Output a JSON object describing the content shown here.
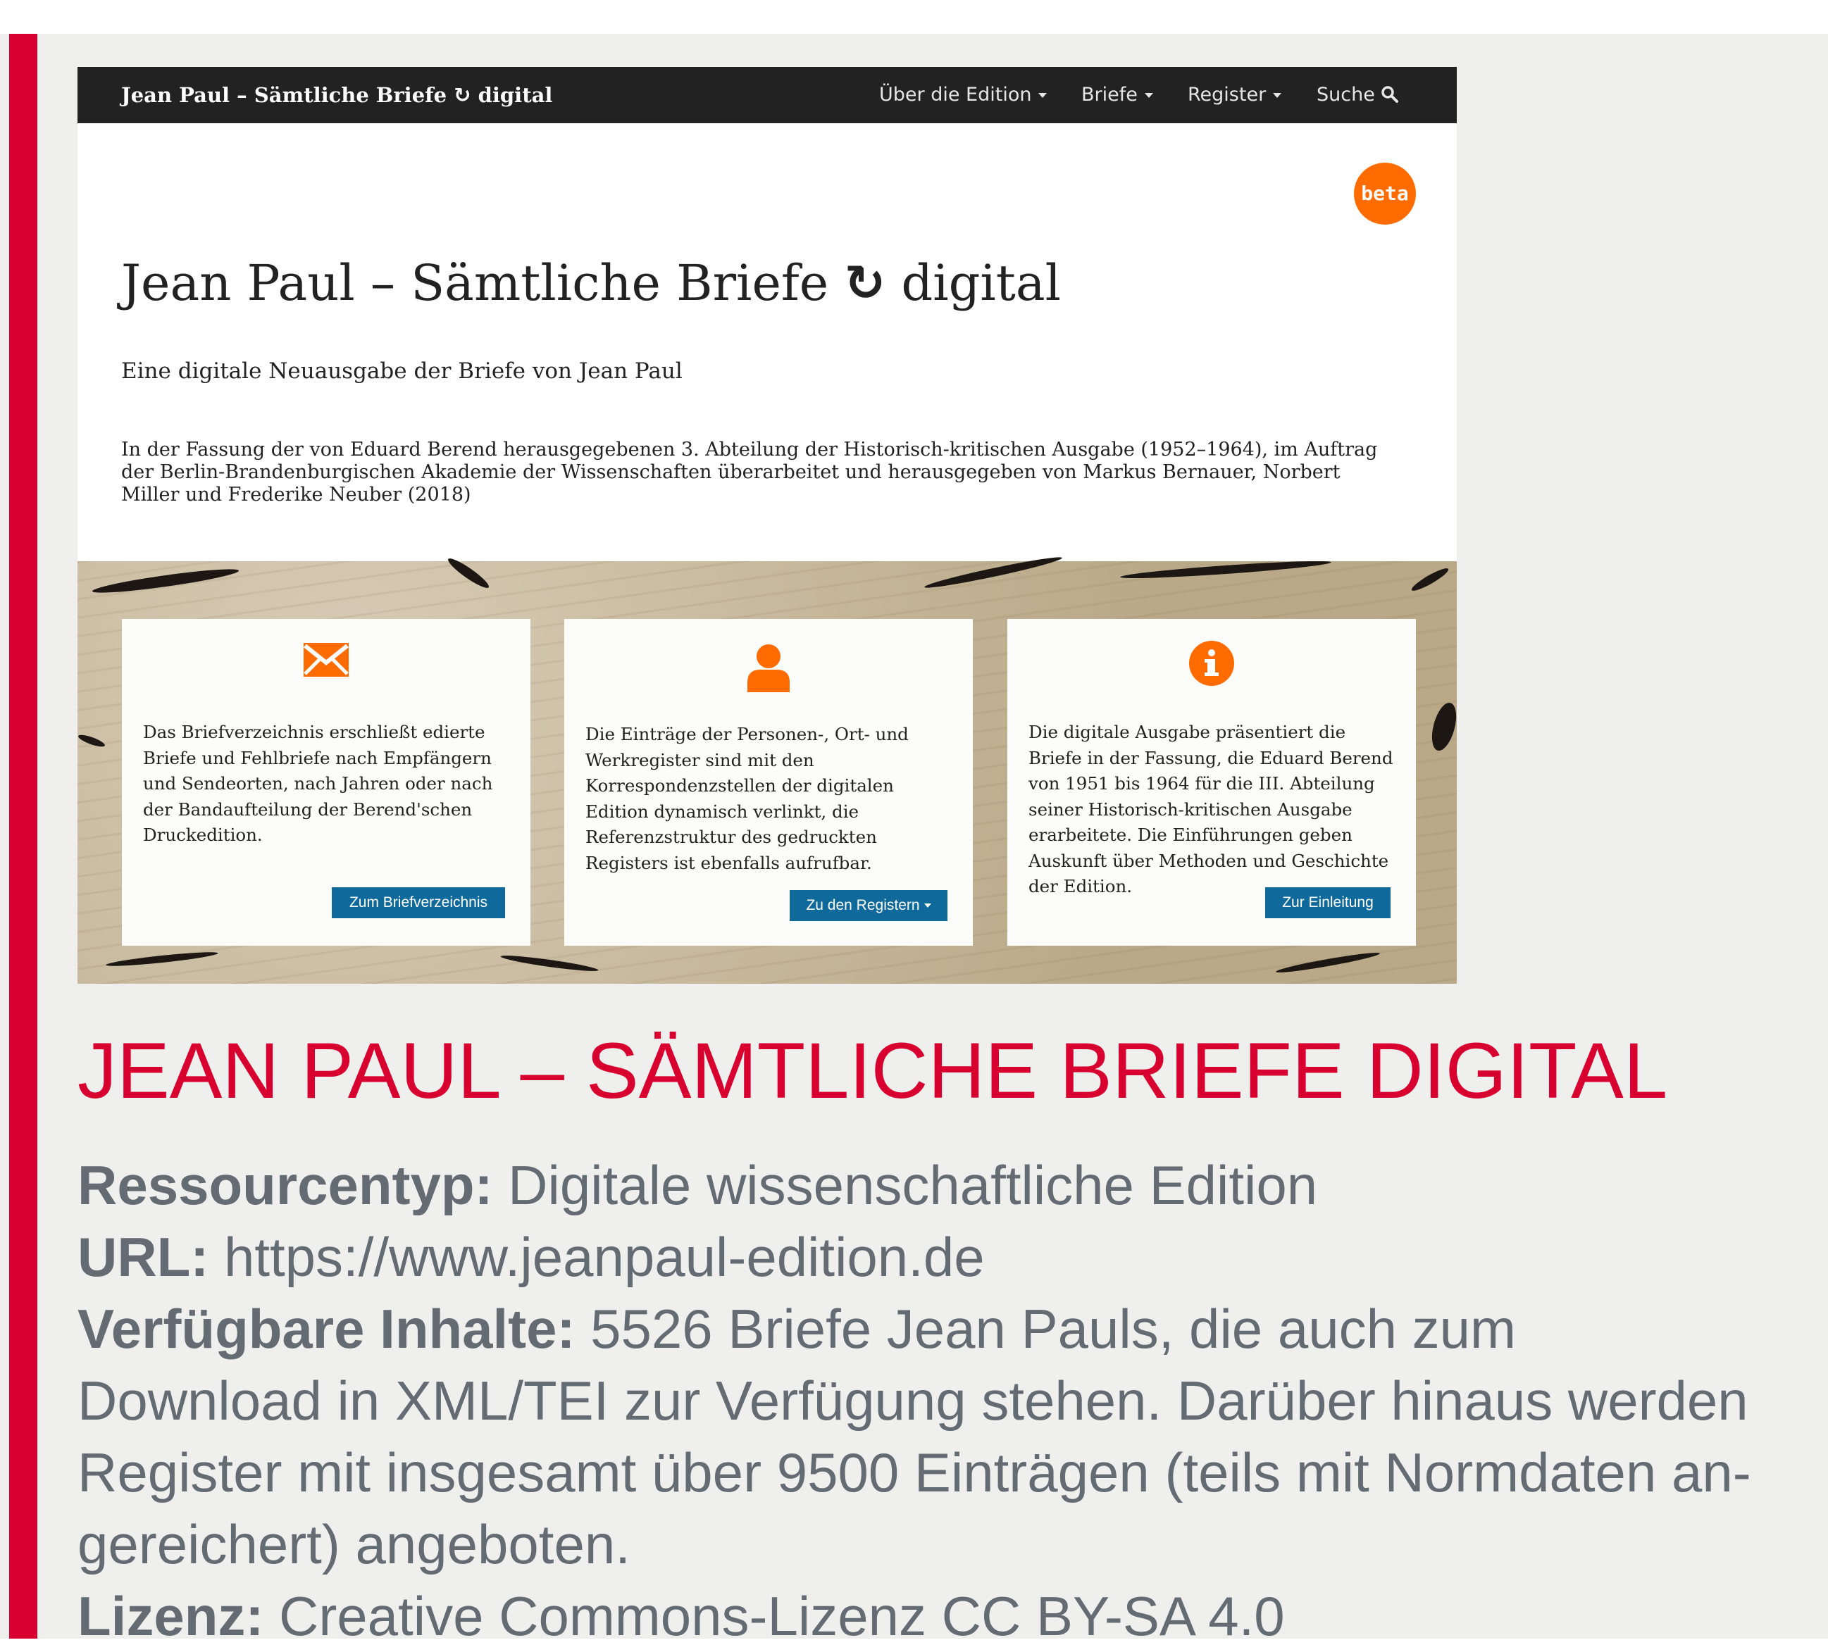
{
  "site": {
    "nav": {
      "brand_pre": "Jean Paul – Sämtliche Briefe",
      "brand_post": "digital",
      "items": [
        {
          "label": "Über die Edition"
        },
        {
          "label": "Briefe"
        },
        {
          "label": "Register"
        }
      ],
      "search_label": "Suche"
    },
    "beta_badge": "beta",
    "title_pre": "Jean Paul – Sämtliche Briefe",
    "title_post": "digital",
    "subtitle": "Eine digitale Neuausgabe der Briefe von Jean Paul",
    "intro": "In der Fassung der von Eduard Berend herausgegebenen 3. Abteilung der Historisch-kritischen Ausgabe (1952–1964), im Auftrag der Berlin-Brandenburgischen Akademie der Wissenschaften überarbeitet und herausgegeben von Markus Bernauer, Norbert Miller und Frederike Neuber (2018)",
    "cards": [
      {
        "icon": "envelope-icon",
        "text": "Das Briefverzeichnis erschließt edierte Briefe und Fehlbriefe nach Empfängern und Sendeorten, nach Jahren oder nach der Bandaufteilung der Berend'schen Druckedition.",
        "button": "Zum Briefverzeichnis"
      },
      {
        "icon": "person-icon",
        "text": "Die Einträge der Personen-, Ort- und Werkregister sind mit den Korrespondenzstellen der digitalen Edition dynamisch verlinkt, die Referenzstruktur des gedruckten Registers ist ebenfalls aufrufbar.",
        "button": "Zu den Registern"
      },
      {
        "icon": "info-icon",
        "text": "Die digitale Ausgabe präsentiert die Briefe in der Fassung, die Eduard Berend von 1951 bis 1964 für die III. Abteilung seiner Historisch-kritischen Ausgabe erarbeitete. Die Einführungen geben Auskunft über Methoden und Geschichte der Edition.",
        "button": "Zur Einleitung"
      }
    ],
    "colors": {
      "navbar": "#222222",
      "accent": "#fe6b00",
      "button": "#0f6a9b"
    }
  },
  "slide": {
    "title": "JEAN PAUL – SÄMTLICHE BRIEFE DIGITAL",
    "resource_type_label": "Ressourcentyp:",
    "resource_type_value": "Digitale wissenschaftliche Edition",
    "url_label": "URL:",
    "url_value": "https://www.jeanpaul-edition.de",
    "contents_label": "Verfügbare Inhalte:",
    "contents_line1": "5526 Briefe Jean Pauls, die auch zum",
    "contents_line2": "Download in XML/TEI zur Verfügung stehen. Darüber hinaus werden",
    "contents_line3": "Register mit insgesamt über 9500 Einträgen (teils mit Normdaten an-",
    "contents_line4": "gereichert) angeboten.",
    "license_label": "Lizenz:",
    "license_value": "Creative Commons-Lizenz CC BY-SA 4.0",
    "colors": {
      "accent": "#d7002e",
      "text": "#656b72",
      "background": "#efefee"
    }
  }
}
